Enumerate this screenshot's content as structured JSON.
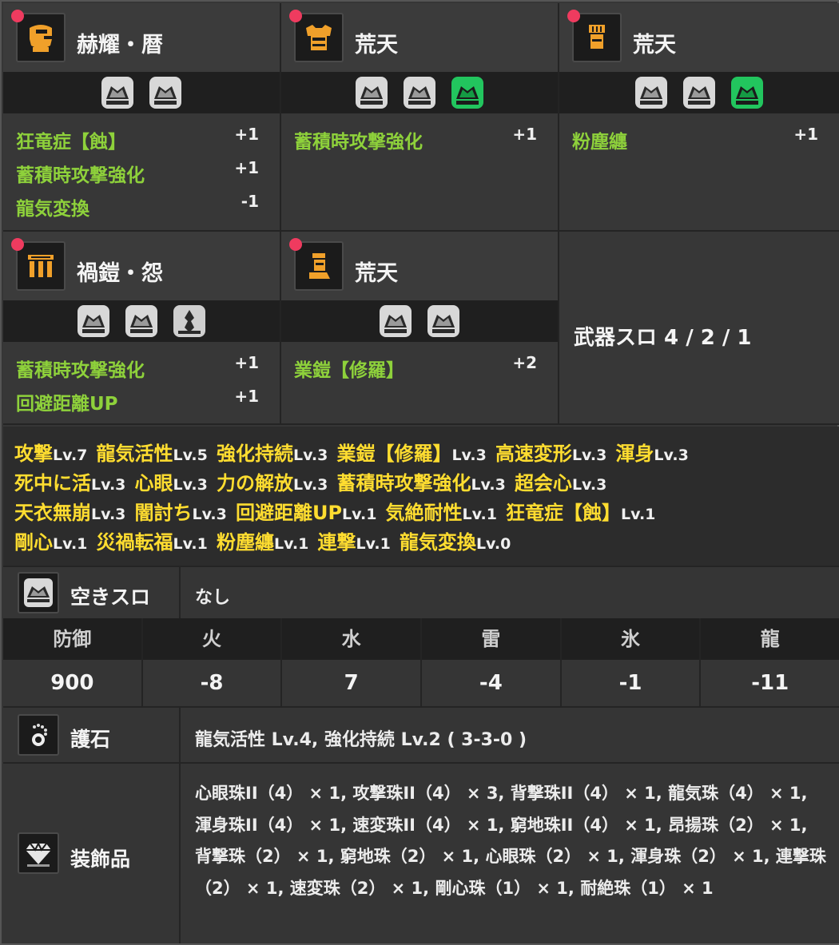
{
  "armor": [
    {
      "name": "赫耀・暦",
      "slots": [
        "lv4",
        "lv4"
      ],
      "icon": "helm-icon",
      "skills": [
        {
          "name": "狂竜症【蝕】",
          "value": "+1"
        },
        {
          "name": "蓄積時攻撃強化",
          "value": "+1"
        },
        {
          "name": "龍気変換",
          "value": "-1"
        }
      ]
    },
    {
      "name": "荒天",
      "slots": [
        "lv4",
        "lv4",
        "lv4-green"
      ],
      "icon": "chest-icon",
      "skills": [
        {
          "name": "蓄積時攻撃強化",
          "value": "+1"
        }
      ]
    },
    {
      "name": "荒天",
      "slots": [
        "lv4",
        "lv4",
        "lv4-green"
      ],
      "icon": "arm-icon",
      "skills": [
        {
          "name": "粉塵纏",
          "value": "+1"
        }
      ]
    },
    {
      "name": "禍鎧・怨",
      "slots": [
        "lv4",
        "lv4",
        "lv1"
      ],
      "icon": "waist-icon",
      "skills": [
        {
          "name": "蓄積時攻撃強化",
          "value": "+1"
        },
        {
          "name": "回避距離UP",
          "value": "+1"
        }
      ]
    },
    {
      "name": "荒天",
      "slots": [
        "lv4",
        "lv4"
      ],
      "icon": "leg-icon",
      "skills": [
        {
          "name": "業鎧【修羅】",
          "value": "+2"
        }
      ]
    }
  ],
  "weapon_slots": "武器スロ 4 / 2 / 1",
  "skill_summary": [
    [
      {
        "n": "攻撃",
        "l": "Lv.7"
      },
      {
        "n": "龍気活性",
        "l": "Lv.5"
      },
      {
        "n": "強化持続",
        "l": "Lv.3"
      },
      {
        "n": "業鎧【修羅】",
        "l": "Lv.3"
      },
      {
        "n": "高速変形",
        "l": "Lv.3"
      },
      {
        "n": "渾身",
        "l": "Lv.3"
      }
    ],
    [
      {
        "n": "死中に活",
        "l": "Lv.3"
      },
      {
        "n": "心眼",
        "l": "Lv.3"
      },
      {
        "n": "力の解放",
        "l": "Lv.3"
      },
      {
        "n": "蓄積時攻撃強化",
        "l": "Lv.3"
      },
      {
        "n": "超会心",
        "l": "Lv.3"
      }
    ],
    [
      {
        "n": "天衣無崩",
        "l": "Lv.3"
      },
      {
        "n": "闇討ち",
        "l": "Lv.3"
      },
      {
        "n": "回避距離UP",
        "l": "Lv.1"
      },
      {
        "n": "気絶耐性",
        "l": "Lv.1"
      },
      {
        "n": "狂竜症【蝕】",
        "l": "Lv.1"
      }
    ],
    [
      {
        "n": "剛心",
        "l": "Lv.1"
      },
      {
        "n": "災禍転福",
        "l": "Lv.1"
      },
      {
        "n": "粉塵纏",
        "l": "Lv.1"
      },
      {
        "n": "連撃",
        "l": "Lv.1"
      },
      {
        "n": "龍気変換",
        "l": "Lv.0"
      }
    ]
  ],
  "empty_slots": {
    "label": "空きスロ",
    "value": "なし"
  },
  "defense": {
    "headers": [
      "防御",
      "火",
      "水",
      "雷",
      "氷",
      "龍"
    ],
    "values": [
      "900",
      "-8",
      "7",
      "-4",
      "-1",
      "-11"
    ]
  },
  "talisman": {
    "label": "護石",
    "value": "龍気活性 Lv.4, 強化持続 Lv.2 ( 3-3-0 )"
  },
  "decorations": {
    "label": "装飾品",
    "value": "心眼珠II（4） × 1, 攻撃珠II（4） × 3, 背撃珠II（4） × 1, 龍気珠（4） × 1, 渾身珠II（4） × 1, 速変珠II（4） × 1, 窮地珠II（4） × 1, 昂揚珠（2） × 1, 背撃珠（2） × 1, 窮地珠（2） × 1, 心眼珠（2） × 1, 渾身珠（2） × 1, 連撃珠（2） × 1, 速変珠（2） × 1, 剛心珠（1） × 1, 耐絶珠（1） × 1"
  },
  "colors": {
    "skill_green": "#8ed13b",
    "skill_yellow": "#ffdd30",
    "red_dot": "#ef3b5f",
    "slot_green": "#22c55e"
  }
}
